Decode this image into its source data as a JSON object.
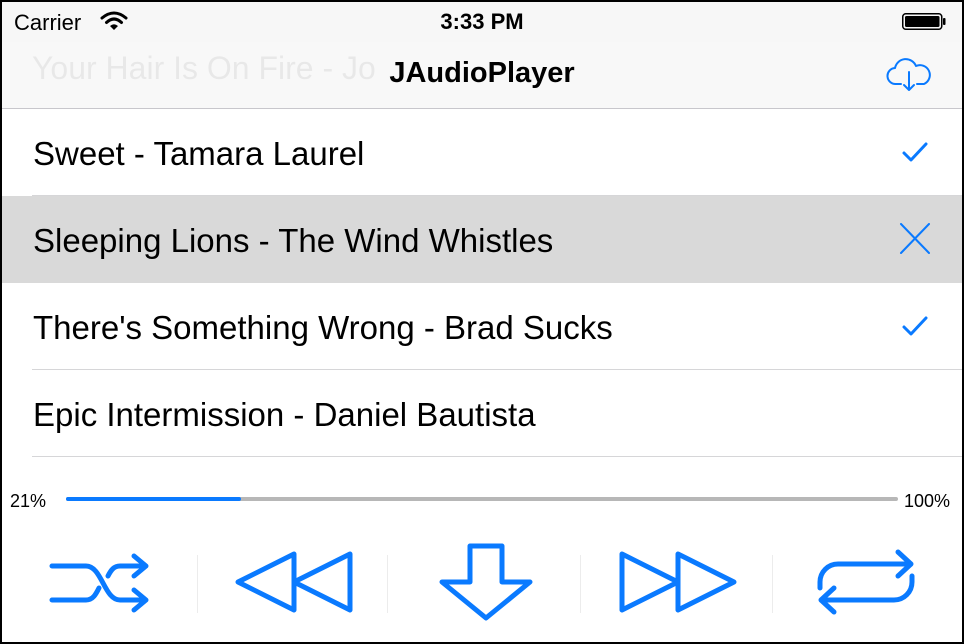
{
  "status": {
    "carrier": "Carrier",
    "time": "3:33 PM"
  },
  "nav": {
    "title": "JAudioPlayer",
    "ghost_text": "Your Hair Is On Fire - Jo",
    "right_icon": "cloud-download-icon"
  },
  "tracks": [
    {
      "label": "Sweet - Tamara Laurel",
      "accessory": "checkmark-icon",
      "selected": false
    },
    {
      "label": "Sleeping Lions - The Wind Whistles",
      "accessory": "close-icon",
      "selected": true
    },
    {
      "label": "There's Something Wrong - Brad Sucks",
      "accessory": "checkmark-icon",
      "selected": false
    },
    {
      "label": "Epic Intermission - Daniel Bautista",
      "accessory": "",
      "selected": false
    }
  ],
  "progress": {
    "left_label": "21%",
    "right_label": "100%",
    "value": 0.21
  },
  "controls": [
    {
      "name": "shuffle-icon"
    },
    {
      "name": "rewind-icon"
    },
    {
      "name": "download-arrow-icon"
    },
    {
      "name": "fast-forward-icon"
    },
    {
      "name": "repeat-icon"
    }
  ],
  "colors": {
    "accent": "#0a7aff",
    "selected_row": "#d9d9d9",
    "track_unfilled": "#b7b7b7"
  }
}
